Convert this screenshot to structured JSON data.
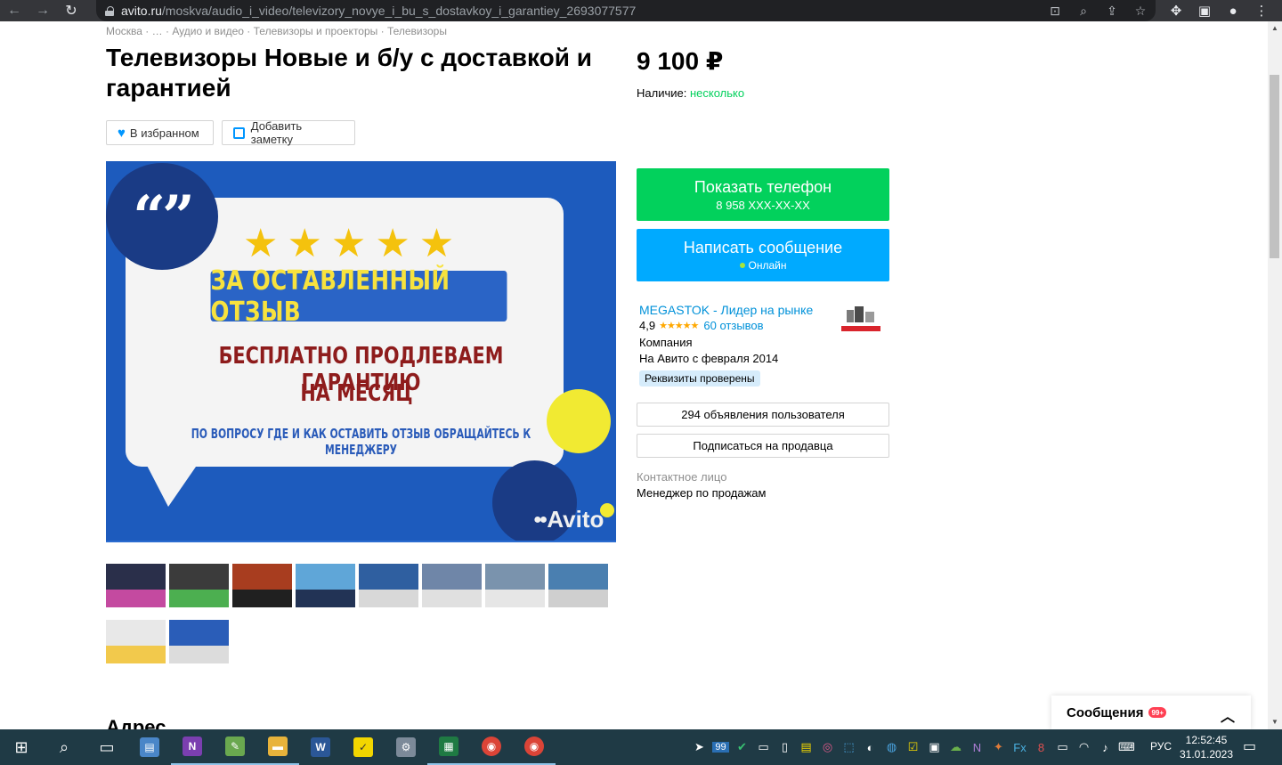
{
  "browser": {
    "url_domain": "avito.ru",
    "url_path": "/moskva/audio_i_video/televizory_novye_i_bu_s_dostavkoy_i_garantiey_2693077577",
    "back_icon": "←",
    "forward_icon": "→",
    "reload_icon": "↻"
  },
  "breadcrumb": {
    "items": [
      "Москва",
      "…",
      "Аудио и видео",
      "Телевизоры и проекторы",
      "Телевизоры"
    ],
    "separator": " · "
  },
  "listing": {
    "title": "Телевизоры Новые и б/у с доставкой и гарантией",
    "favorite_label": "В избранном",
    "note_label": "Добавить заметку",
    "price": "9 100 ₽",
    "availability_label": "Наличие:",
    "availability_value": "несколько"
  },
  "image": {
    "stars": "★★★★★",
    "ribbon_text": "ЗА ОСТАВЛЕННЫЙ ОТЗЫВ",
    "line1": "БЕСПЛАТНО ПРОДЛЕВАЕМ ГАРАНТИЮ",
    "line2": "НА МЕСЯЦ",
    "line3": "ПО ВОПРОСУ ГДЕ И КАК ОСТАВИТЬ ОТЗЫВ ОБРАЩАЙТЕСЬ К МЕНЕДЖЕРУ",
    "logo_text": "Avito",
    "quote_text": "“”"
  },
  "thumbnails": [
    {
      "colors": [
        "#2a2f4a",
        "#c44aa0"
      ]
    },
    {
      "colors": [
        "#3b3b3b",
        "#4caf50"
      ]
    },
    {
      "colors": [
        "#a83d1f",
        "#202020"
      ]
    },
    {
      "colors": [
        "#5fa6d8",
        "#223355"
      ]
    },
    {
      "colors": [
        "#2f5fa0",
        "#d8d8d8"
      ]
    },
    {
      "colors": [
        "#6f86a8",
        "#e0e0e0"
      ]
    },
    {
      "colors": [
        "#7a93ad",
        "#e6e6e6"
      ]
    },
    {
      "colors": [
        "#4a7fb0",
        "#cfcfcf"
      ]
    },
    {
      "colors": [
        "#e8e8e8",
        "#f2c94c"
      ]
    },
    {
      "colors": [
        "#2a5db8",
        "#dcdcdc"
      ]
    }
  ],
  "contact": {
    "phone_button": "Показать телефон",
    "phone_number": "8 958 XXX-XX-XX",
    "message_button": "Написать сообщение",
    "online_status": "Онлайн"
  },
  "seller": {
    "name": "MEGASTOK - Лидер на рынке",
    "rating": "4,9",
    "rating_stars": "★★★★★",
    "reviews": "60 отзывов",
    "type": "Компания",
    "since": "На Авито с февраля 2014",
    "verified": "Реквизиты проверены",
    "ads_button": "294 объявления пользователя",
    "subscribe_button": "Подписаться на продавца",
    "contact_label": "Контактное лицо",
    "contact_value": "Менеджер по продажам"
  },
  "address_heading": "Адрес",
  "messages_widget": {
    "label": "Сообщения",
    "badge": "99+",
    "chevron": "︿"
  },
  "taskbar": {
    "tray_count": "99",
    "lang": "РУС",
    "time": "12:52:45",
    "date": "31.01.2023"
  }
}
